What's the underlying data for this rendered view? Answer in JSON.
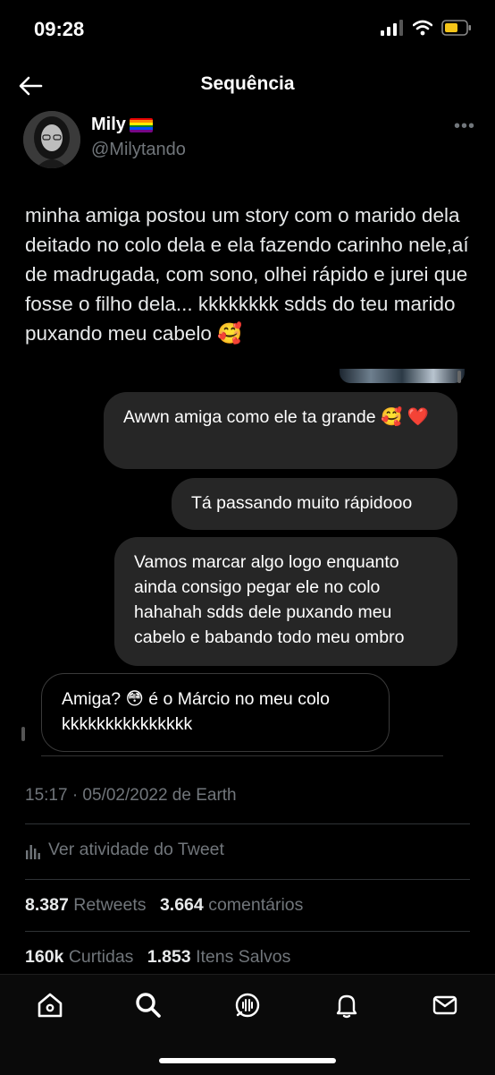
{
  "status_bar": {
    "time": "09:28"
  },
  "header": {
    "title": "Sequência"
  },
  "tweet": {
    "author_name": "Mily",
    "handle": "@Milytando",
    "text": "minha amiga postou um story com o marido dela deitado no colo dela e ela fazendo carinho nele,aí de madrugada, com sono, olhei rápido e jurei que fosse o filho dela... kkkkkkkk sdds do teu marido puxando meu cabelo 🥰",
    "embedded_chat": [
      {
        "from": "me",
        "text": "Awwn amiga como ele ta grande 🥰 ❤️"
      },
      {
        "from": "me",
        "text": "Tá passando muito rápidooo"
      },
      {
        "from": "me",
        "text": "Vamos marcar algo logo enquanto ainda consigo pegar ele no colo hahahah sdds dele puxando meu cabelo e babando todo meu ombro"
      },
      {
        "from": "them",
        "text": "Amiga? 😳  é o Márcio no meu colo kkkkkkkkkkkkkkk"
      }
    ],
    "timestamp": "15:17 · 05/02/2022 de Earth",
    "activity_label": "Ver atividade do Tweet",
    "stats": {
      "retweets_count": "8.387",
      "retweets_label": "Retweets",
      "comments_count": "3.664",
      "comments_label": "comentários",
      "likes_count": "160k",
      "likes_label": "Curtidas",
      "saves_count": "1.853",
      "saves_label": "Itens Salvos"
    }
  },
  "tab_bar": {
    "items": [
      {
        "icon": "home-icon"
      },
      {
        "icon": "search-icon"
      },
      {
        "icon": "spaces-icon"
      },
      {
        "icon": "notifications-icon"
      },
      {
        "icon": "messages-icon"
      }
    ]
  },
  "colors": {
    "background": "#000000",
    "bubble": "#262626",
    "muted": "#71767b"
  }
}
